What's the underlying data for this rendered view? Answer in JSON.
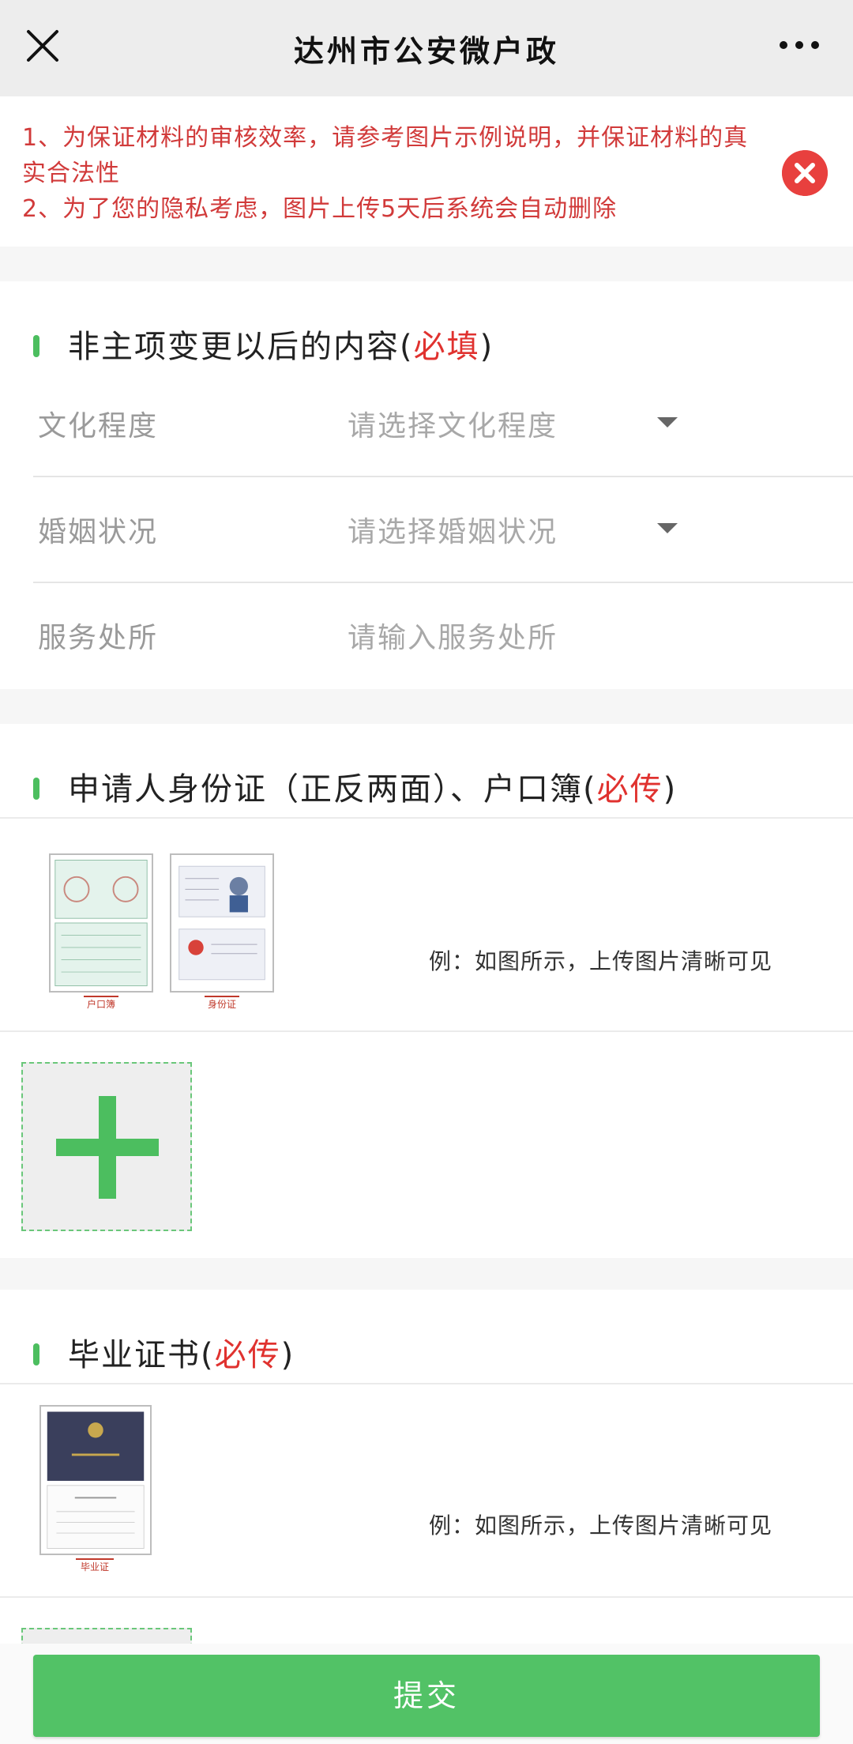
{
  "titlebar": {
    "title": "达州市公安微户政"
  },
  "notice": {
    "line1": "1、为保证材料的审核效率，请参考图片示例说明，并保证材料的真实合法性",
    "line2": "2、为了您的隐私考虑，图片上传5天后系统会自动删除"
  },
  "section1": {
    "title": "非主项变更以后的内容",
    "required_open": "(",
    "required": "必填",
    "required_close": ")",
    "rows": [
      {
        "label": "文化程度",
        "value": "请选择文化程度"
      },
      {
        "label": "婚姻状况",
        "value": "请选择婚姻状况"
      },
      {
        "label": "服务处所",
        "value": "请输入服务处所"
      }
    ]
  },
  "section2": {
    "title": "申请人身份证（正反两面）、户口簿",
    "required_open": "(",
    "required": "必传",
    "required_close": ")",
    "captions": [
      "户口簿",
      "身份证"
    ],
    "example_text": "例：如图所示，上传图片清晰可见"
  },
  "section3": {
    "title": "毕业证书",
    "required_open": "(",
    "required": "必传",
    "required_close": ")",
    "captions": [
      "毕业证"
    ],
    "example_text": "例：如图所示，上传图片清晰可见"
  },
  "submit": {
    "label": "提交"
  },
  "colors": {
    "accent": "#52c266",
    "required": "#e0322f",
    "notice": "#d13a3a"
  }
}
